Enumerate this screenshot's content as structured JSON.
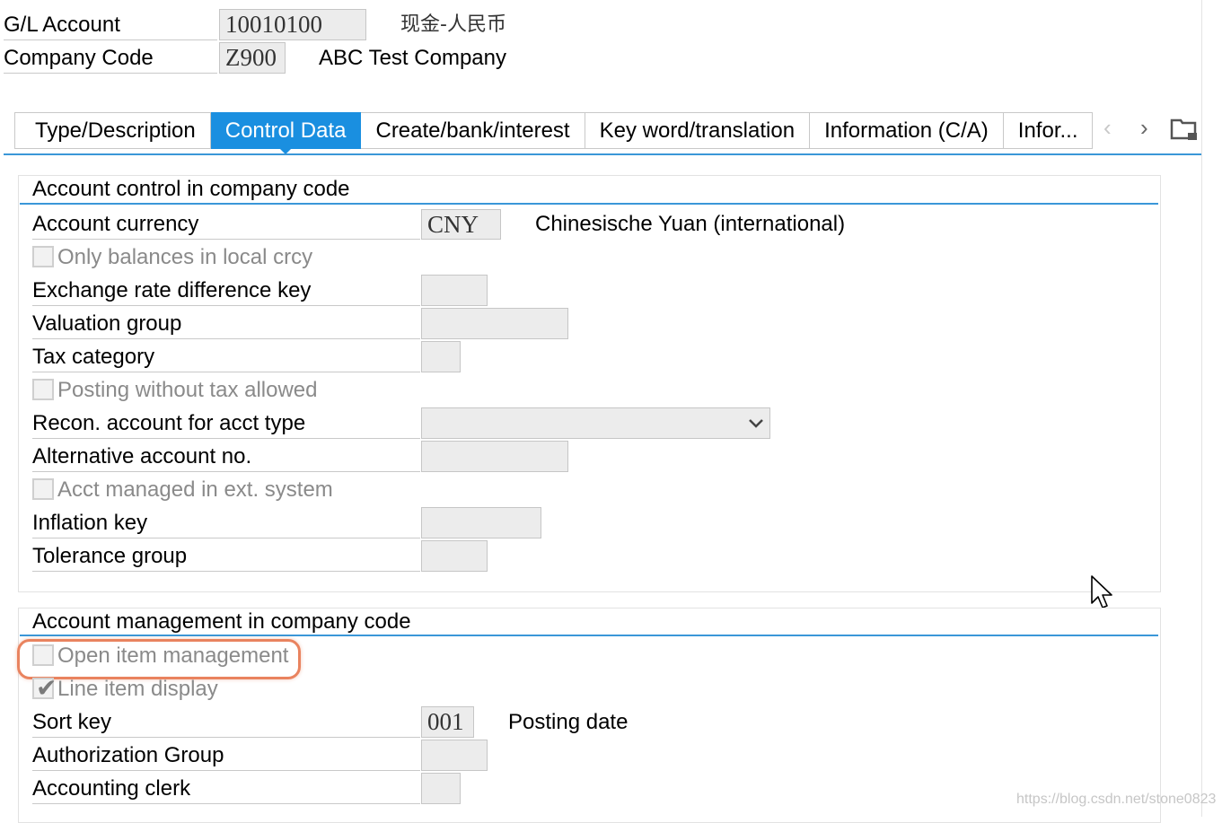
{
  "header": {
    "gl_account_label": "G/L Account",
    "gl_account_value": "10010100",
    "gl_account_desc": "现金-人民币",
    "company_code_label": "Company Code",
    "company_code_value": "Z900",
    "company_code_desc": "ABC Test Company"
  },
  "tabs": [
    {
      "label": "Type/Description",
      "active": false
    },
    {
      "label": "Control Data",
      "active": true
    },
    {
      "label": "Create/bank/interest",
      "active": false
    },
    {
      "label": "Key word/translation",
      "active": false
    },
    {
      "label": "Information (C/A)",
      "active": false
    },
    {
      "label": "Infor...",
      "active": false
    }
  ],
  "tab_nav": {
    "prev_icon": "chevron-left-icon",
    "next_icon": "chevron-right-icon",
    "menu_icon": "tab-list-icon"
  },
  "account_control": {
    "title": "Account control in company code",
    "account_currency_label": "Account currency",
    "account_currency_value": "CNY",
    "account_currency_desc": "Chinesische Yuan (international)",
    "only_balances_label": "Only balances in local crcy",
    "only_balances_checked": false,
    "exchange_rate_key_label": "Exchange rate difference key",
    "exchange_rate_key_value": "",
    "valuation_group_label": "Valuation group",
    "valuation_group_value": "",
    "tax_category_label": "Tax category",
    "tax_category_value": "",
    "posting_without_tax_label": "Posting without tax allowed",
    "posting_without_tax_checked": false,
    "recon_account_label": "Recon. account for acct type",
    "recon_account_value": "",
    "alt_account_label": "Alternative account no.",
    "alt_account_value": "",
    "acct_managed_ext_label": "Acct managed in ext. system",
    "acct_managed_ext_checked": false,
    "inflation_key_label": "Inflation key",
    "inflation_key_value": "",
    "tolerance_group_label": "Tolerance group",
    "tolerance_group_value": ""
  },
  "account_management": {
    "title": "Account management in company code",
    "open_item_label": "Open item management",
    "open_item_checked": false,
    "line_item_label": "Line item display",
    "line_item_checked": true,
    "sort_key_label": "Sort key",
    "sort_key_value": "001",
    "sort_key_desc": "Posting date",
    "auth_group_label": "Authorization Group",
    "auth_group_value": "",
    "accounting_clerk_label": "Accounting clerk",
    "accounting_clerk_value": ""
  },
  "colors": {
    "accent": "#1a8fe0",
    "highlight": "#e9835f",
    "field_bg": "#ececec"
  },
  "watermark": "https://blog.csdn.net/stone0823"
}
